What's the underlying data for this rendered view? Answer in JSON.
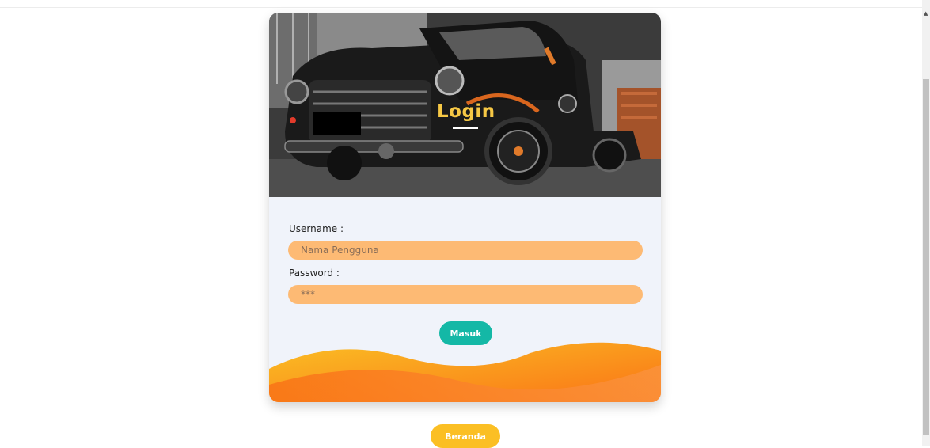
{
  "login": {
    "title": "Login",
    "hero_image": "vintage-truck-photo"
  },
  "form": {
    "username_label": "Username :",
    "username_placeholder": "Nama Pengguna",
    "password_label": "Password :",
    "password_placeholder": "***",
    "submit_label": "Masuk"
  },
  "footer": {
    "home_label": "Beranda"
  },
  "colors": {
    "accent_title": "#f6c845",
    "input_bg": "#fdba74",
    "submit_bg": "#14b8a6",
    "home_bg": "#fbbf24",
    "wave_orange": "#f97316"
  }
}
